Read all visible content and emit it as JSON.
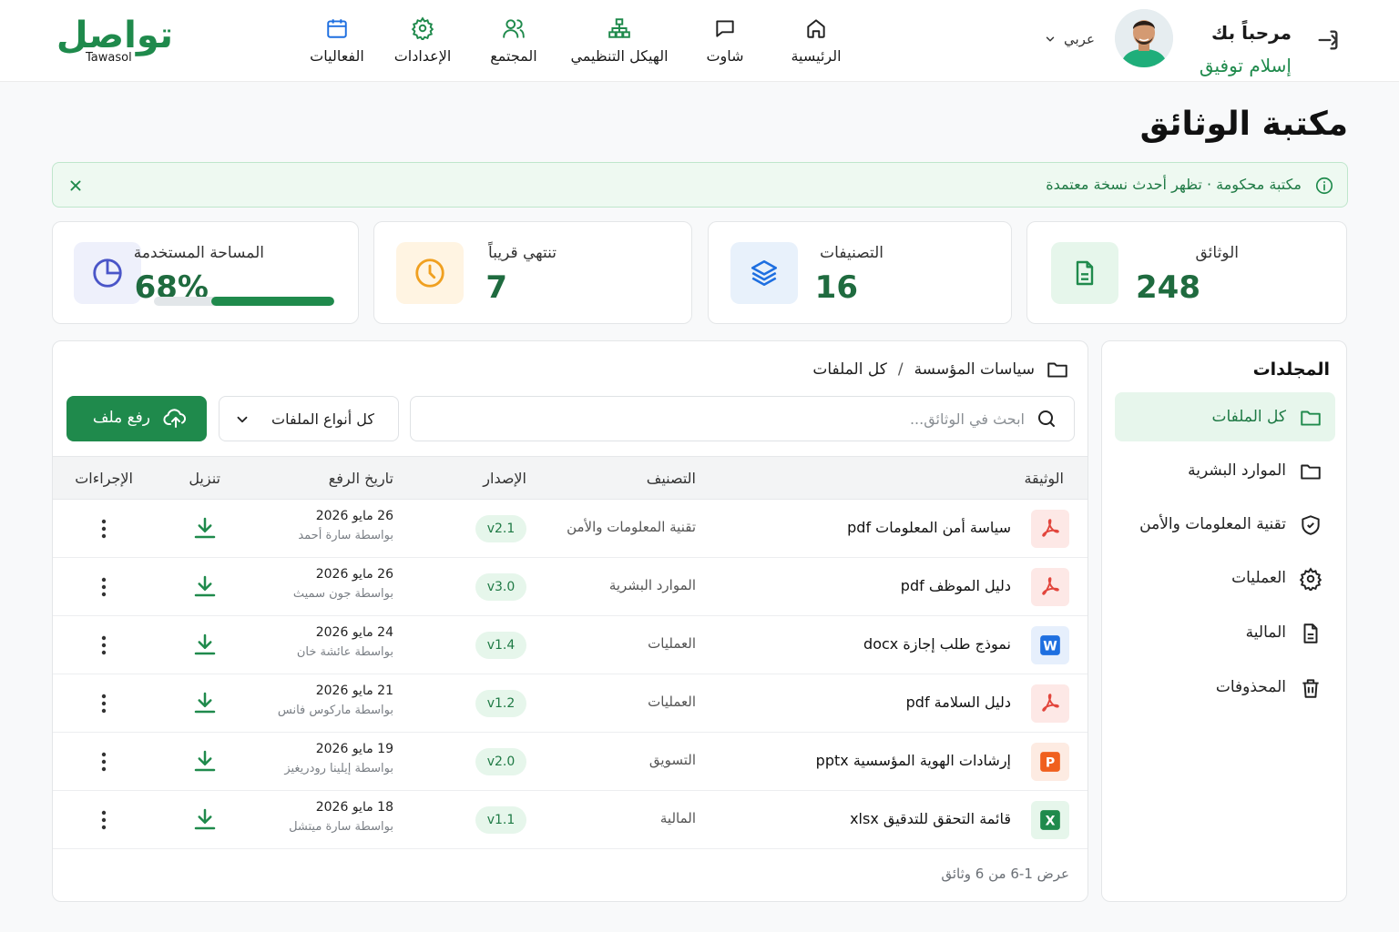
{
  "header": {
    "logo_ar": "تواصل",
    "logo_en": "Tawasol",
    "greeting": "مرحباً بك",
    "user_name": "إسلام توفيق",
    "language": "عربي",
    "nav": [
      {
        "label": "الرئيسية",
        "icon": "home-icon"
      },
      {
        "label": "شاوت",
        "icon": "chat-icon"
      },
      {
        "label": "الهيكل التنظيمي",
        "icon": "org-chart-icon"
      },
      {
        "label": "المجتمع",
        "icon": "users-icon"
      },
      {
        "label": "الإعدادات",
        "icon": "gear-icon"
      },
      {
        "label": "الفعاليات",
        "icon": "calendar-icon"
      }
    ]
  },
  "page": {
    "title": "مكتبة الوثائق"
  },
  "alert": {
    "text": "مكتبة محكومة · تظهر أحدث نسخة معتمدة"
  },
  "stats": {
    "documents": {
      "label": "الوثائق",
      "value": "248",
      "icon": "document-icon"
    },
    "categories": {
      "label": "التصنيفات",
      "value": "16",
      "icon": "layers-icon"
    },
    "expiring": {
      "label": "تنتهي قريباً",
      "value": "7",
      "icon": "clock-icon"
    },
    "storage": {
      "label": "المساحة المستخدمة",
      "value": "68%",
      "percent": 68,
      "icon": "pie-chart-icon"
    }
  },
  "sidebar": {
    "title": "المجلدات",
    "items": [
      {
        "label": "كل الملفات",
        "icon": "folder-icon",
        "active": true
      },
      {
        "label": "الموارد البشرية",
        "icon": "folder-icon"
      },
      {
        "label": "تقنية المعلومات والأمن",
        "icon": "shield-icon"
      },
      {
        "label": "العمليات",
        "icon": "gear-icon"
      },
      {
        "label": "المالية",
        "icon": "file-icon"
      },
      {
        "label": "المحذوفات",
        "icon": "trash-icon"
      }
    ]
  },
  "main": {
    "breadcrumb": [
      "سياسات المؤسسة",
      "/",
      "كل الملفات"
    ],
    "search_placeholder": "ابحث في الوثائق...",
    "filter_label": "كل أنواع الملفات",
    "upload_label": "رفع ملف",
    "columns": {
      "document": "الوثيقة",
      "category": "التصنيف",
      "version": "الإصدار",
      "upload_date": "تاريخ الرفع",
      "download": "تنزيل",
      "actions": "الإجراءات"
    },
    "rows": [
      {
        "name": "سياسة أمن المعلومات pdf",
        "type": "pdf",
        "category": "تقنية المعلومات والأمن",
        "version": "v2.1",
        "date": "26 مايو 2026",
        "by": "بواسطة سارة أحمد"
      },
      {
        "name": "دليل الموظف pdf",
        "type": "pdf",
        "category": "الموارد البشرية",
        "version": "v3.0",
        "date": "26 مايو 2026",
        "by": "بواسطة جون سميث"
      },
      {
        "name": "نموذج طلب إجازة docx",
        "type": "docx",
        "category": "العمليات",
        "version": "v1.4",
        "date": "24 مايو 2026",
        "by": "بواسطة عائشة خان"
      },
      {
        "name": "دليل السلامة pdf",
        "type": "pdf",
        "category": "العمليات",
        "version": "v1.2",
        "date": "21 مايو 2026",
        "by": "بواسطة ماركوس فانس"
      },
      {
        "name": "إرشادات الهوية المؤسسية pptx",
        "type": "pptx",
        "category": "التسويق",
        "version": "v2.0",
        "date": "19 مايو 2026",
        "by": "بواسطة إيلينا رودريغيز"
      },
      {
        "name": "قائمة التحقق للتدقيق xlsx",
        "type": "xlsx",
        "category": "المالية",
        "version": "v1.1",
        "date": "18 مايو 2026",
        "by": "بواسطة سارة ميتشل"
      }
    ],
    "footer": "عرض 1-6 من 6 وثائق"
  },
  "colors": {
    "brand": "#1f8a4c",
    "pdf": "#e2453c",
    "docx": "#1e6fe0",
    "pptx": "#f0601e",
    "xlsx": "#1f8a4c"
  }
}
